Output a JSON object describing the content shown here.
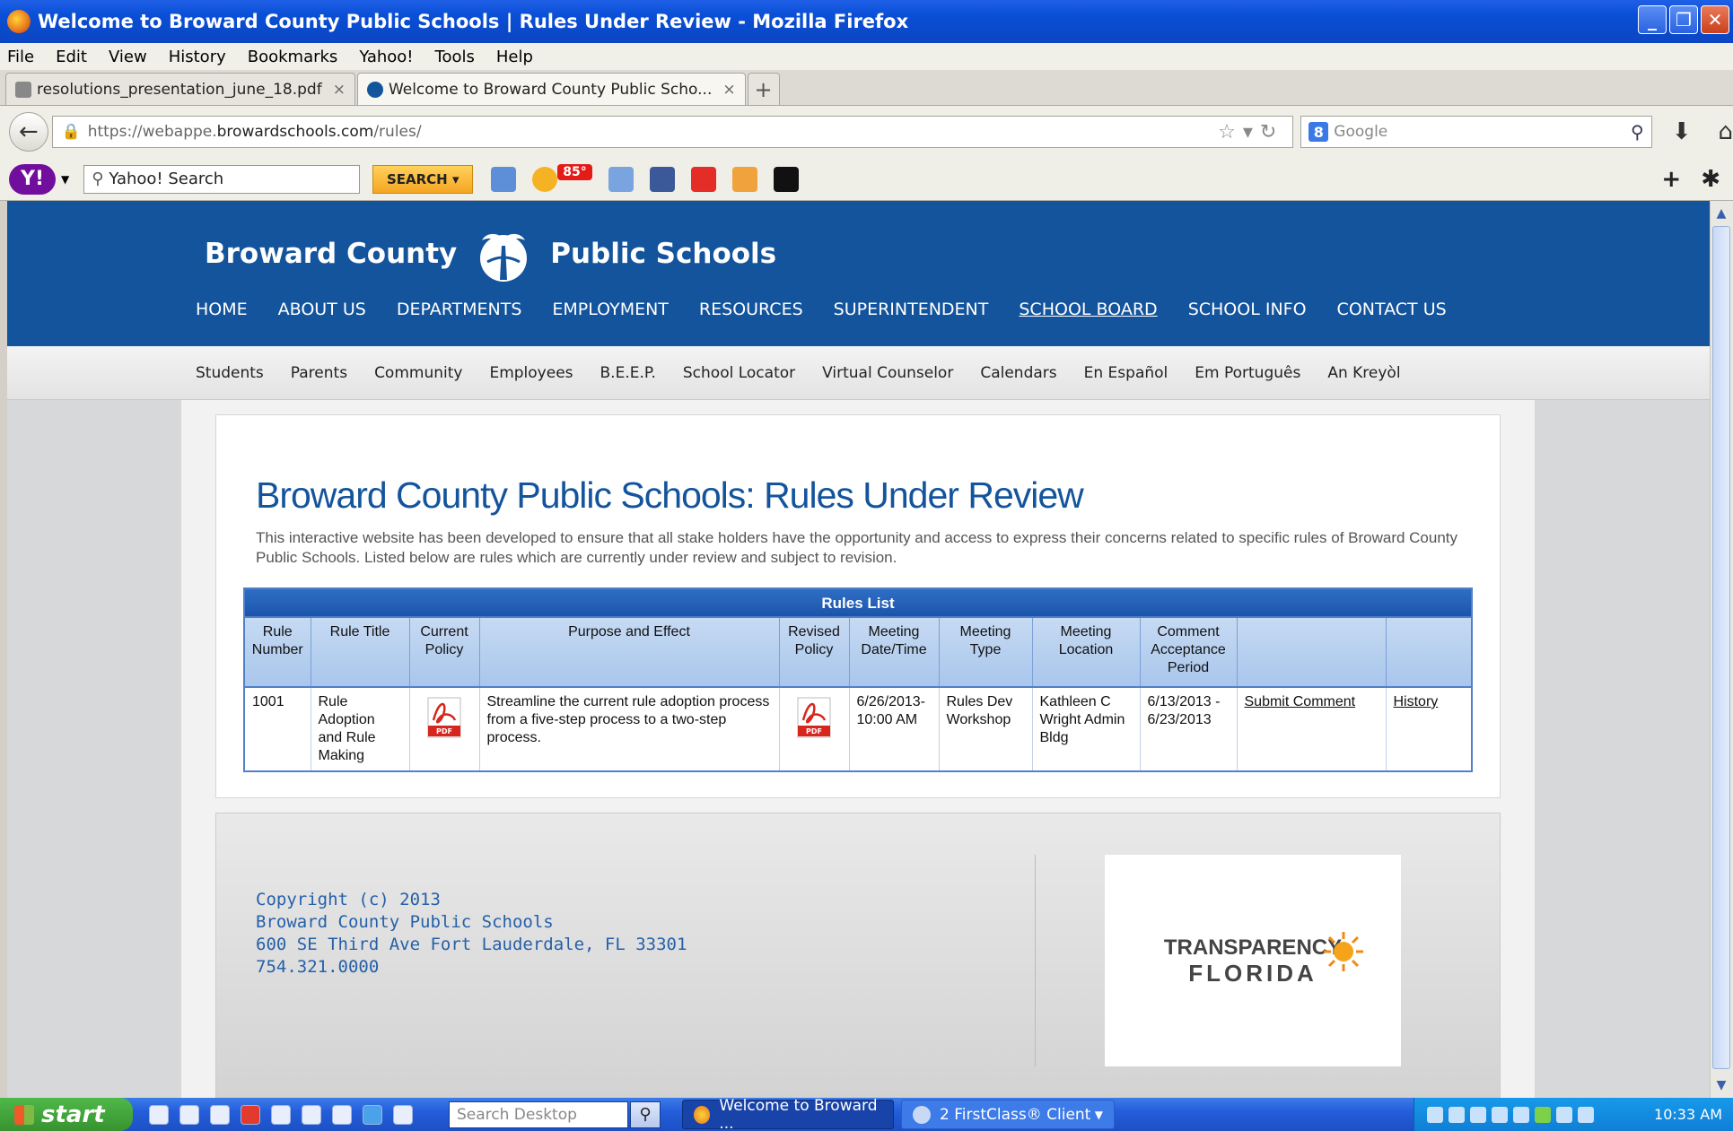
{
  "window": {
    "title": "Welcome to Broward County Public Schools | Rules Under Review - Mozilla Firefox"
  },
  "menu": [
    "File",
    "Edit",
    "View",
    "History",
    "Bookmarks",
    "Yahoo!",
    "Tools",
    "Help"
  ],
  "tabs": [
    {
      "label": "resolutions_presentation_june_18.pdf",
      "active": false
    },
    {
      "label": "Welcome to Broward County Public Scho...",
      "active": true
    }
  ],
  "urlbar": {
    "prefix": "https://webappe.",
    "domain": "browardschools.com",
    "path": "/rules/"
  },
  "searchbar": {
    "engine": "Google"
  },
  "yahoo": {
    "search_placeholder": "Yahoo! Search",
    "search_button": "SEARCH",
    "weather_badge": "85°"
  },
  "site": {
    "brand_left": "Broward County",
    "brand_right": "Public Schools",
    "main_nav": [
      "HOME",
      "ABOUT US",
      "DEPARTMENTS",
      "EMPLOYMENT",
      "RESOURCES",
      "SUPERINTENDENT",
      "SCHOOL BOARD",
      "SCHOOL INFO",
      "CONTACT US"
    ],
    "sub_nav": [
      "Students",
      "Parents",
      "Community",
      "Employees",
      "B.E.E.P.",
      "School Locator",
      "Virtual Counselor",
      "Calendars",
      "En Español",
      "Em Português",
      "An Kreyòl"
    ]
  },
  "content": {
    "title": "Broward County Public Schools: Rules Under Review",
    "intro": "This interactive website has been developed to ensure that all stake holders have the opportunity and access to express their concerns related to specific rules of Broward County Public Schools. Listed below are rules which are currently under review and subject to revision.",
    "table": {
      "caption": "Rules List",
      "headers": [
        "Rule Number",
        "Rule Title",
        "Current Policy",
        "Purpose and Effect",
        "Revised Policy",
        "Meeting Date/Time",
        "Meeting Type",
        "Meeting Location",
        "Comment Acceptance Period",
        "",
        ""
      ],
      "rows": [
        {
          "number": "1001",
          "title": "Rule Adoption and Rule Making",
          "current_policy": "PDF",
          "purpose": "Streamline the current rule adoption process from a five-step process to a two-step process.",
          "revised_policy": "PDF",
          "meeting_datetime": "6/26/2013- 10:00 AM",
          "meeting_type": "Rules Dev Workshop",
          "meeting_location": "Kathleen C Wright Admin Bldg",
          "comment_period": "6/13/2013 - 6/23/2013",
          "submit_link": "Submit Comment",
          "history_link": "History"
        }
      ]
    }
  },
  "footer": {
    "copyright": "Copyright (c) 2013",
    "org": "Broward County Public Schools",
    "address": "600 SE Third Ave Fort Lauderdale, FL 33301",
    "phone": "754.321.0000",
    "logo_line1": "TRANSPARENCY",
    "logo_line2": "FLORIDA"
  },
  "taskbar": {
    "start": "start",
    "search_placeholder": "Search Desktop",
    "tasks": [
      "Welcome to Broward ...",
      "2 FirstClass® Client"
    ],
    "clock": "10:33 AM"
  },
  "colors": {
    "brand_blue": "#13549c",
    "link_blue": "#2560a8",
    "table_header": "#1b55ab"
  }
}
